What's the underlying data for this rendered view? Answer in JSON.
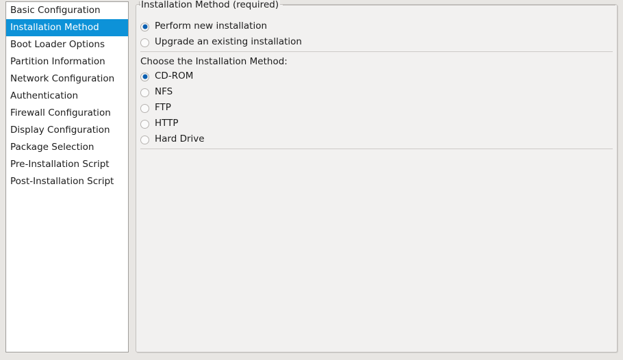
{
  "sidebar": {
    "items": [
      {
        "label": "Basic Configuration",
        "selected": false
      },
      {
        "label": "Installation Method",
        "selected": true
      },
      {
        "label": "Boot Loader Options",
        "selected": false
      },
      {
        "label": "Partition Information",
        "selected": false
      },
      {
        "label": "Network Configuration",
        "selected": false
      },
      {
        "label": "Authentication",
        "selected": false
      },
      {
        "label": "Firewall Configuration",
        "selected": false
      },
      {
        "label": "Display Configuration",
        "selected": false
      },
      {
        "label": "Package Selection",
        "selected": false
      },
      {
        "label": "Pre-Installation Script",
        "selected": false
      },
      {
        "label": "Post-Installation Script",
        "selected": false
      }
    ]
  },
  "panel": {
    "groupbox_title": "Installation Method (required)",
    "install_type": {
      "options": [
        {
          "label": "Perform new installation",
          "checked": true
        },
        {
          "label": "Upgrade an existing installation",
          "checked": false
        }
      ]
    },
    "method_heading": "Choose the Installation Method:",
    "method": {
      "options": [
        {
          "label": "CD-ROM",
          "checked": true
        },
        {
          "label": "NFS",
          "checked": false
        },
        {
          "label": "FTP",
          "checked": false
        },
        {
          "label": "HTTP",
          "checked": false
        },
        {
          "label": "Hard Drive",
          "checked": false
        }
      ]
    }
  },
  "colors": {
    "selection_blue": "#0d92d8",
    "radio_dot_blue": "#0b5fb0",
    "panel_bg": "#f2f1f0",
    "page_bg": "#e8e6e3",
    "list_bg": "#ffffff"
  }
}
